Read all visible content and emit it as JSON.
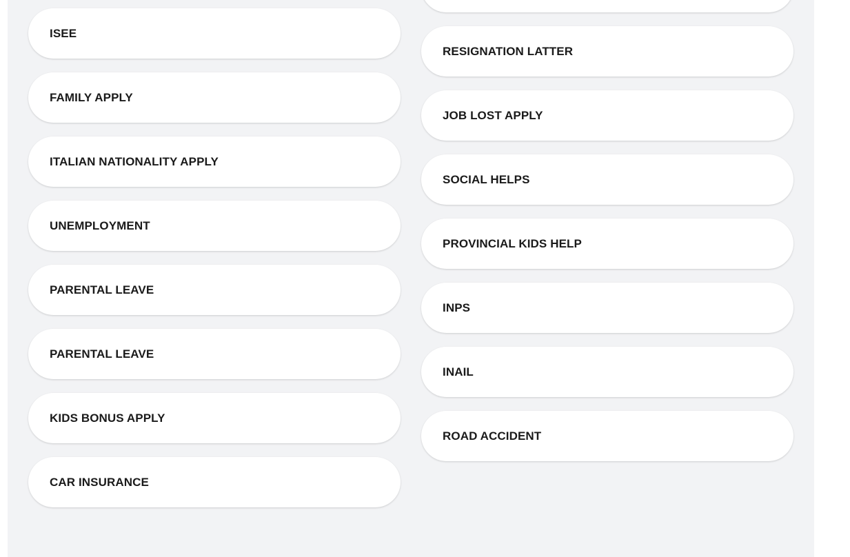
{
  "services_left": [
    {
      "label": "ISEE"
    },
    {
      "label": "FAMILY APPLY"
    },
    {
      "label": "ITALIAN NATIONALITY APPLY"
    },
    {
      "label": "UNEMPLOYMENT"
    },
    {
      "label": "PARENTAL LEAVE"
    },
    {
      "label": "PARENTAL LEAVE"
    },
    {
      "label": "KIDS BONUS APPLY"
    },
    {
      "label": "CAR INSURANCE"
    }
  ],
  "services_right": [
    {
      "label": ""
    },
    {
      "label": "RESIGNATION LATTER"
    },
    {
      "label": "JOB LOST APPLY"
    },
    {
      "label": "SOCIAL HELPS"
    },
    {
      "label": "PROVINCIAL KIDS HELP"
    },
    {
      "label": "INPS"
    },
    {
      "label": "INAIL"
    },
    {
      "label": "ROAD ACCIDENT"
    }
  ]
}
